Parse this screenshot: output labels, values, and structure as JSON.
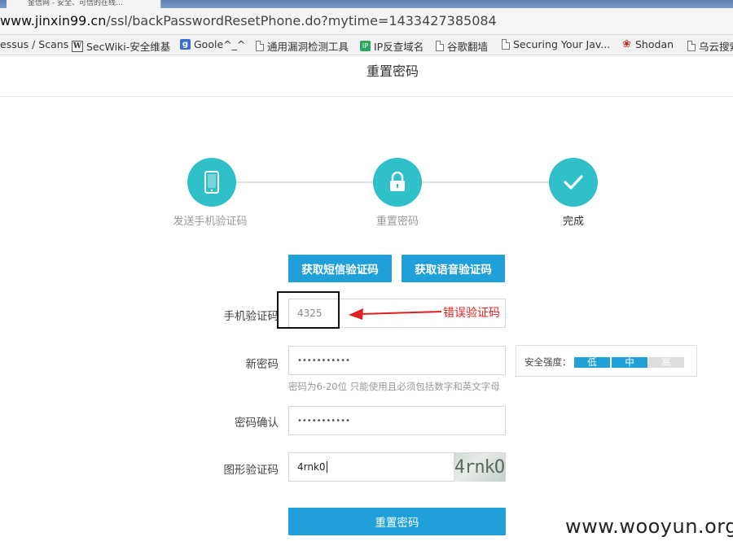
{
  "browser": {
    "tab_title": "金信网 - 安全、可信的在线…",
    "url_host": "www.jinxin99.cn",
    "url_path": "/ssl/backPasswordResetPhone.do?mytime=1433427385084",
    "bookmarks": [
      {
        "label": "essus / Scans",
        "icon": "none"
      },
      {
        "label": "SecWiki-安全维基",
        "icon": "w-icon"
      },
      {
        "label": "Goole^_^",
        "icon": "google-icon"
      },
      {
        "label": "通用漏洞检测工具",
        "icon": "page-icon"
      },
      {
        "label": "IP反查域名",
        "icon": "ip-icon"
      },
      {
        "label": "谷歌翻墙",
        "icon": "page-icon"
      },
      {
        "label": "Securing Your Jav...",
        "icon": "page-icon"
      },
      {
        "label": "Shodan",
        "icon": "shodan-icon"
      },
      {
        "label": "乌云搜索",
        "icon": "page-icon"
      }
    ]
  },
  "page": {
    "title": "重置密码",
    "steps": [
      {
        "label": "发送手机验证码",
        "icon": "phone-icon"
      },
      {
        "label": "重置密码",
        "icon": "lock-icon"
      },
      {
        "label": "完成",
        "icon": "check-icon"
      }
    ],
    "sms_button": "获取短信验证码",
    "voice_button": "获取语音验证码",
    "form": {
      "sms_code": {
        "label": "手机验证码",
        "value": "4325"
      },
      "new_password": {
        "label": "新密码",
        "value": "•••••••••••",
        "hint": "密码为6-20位 只能使用且必须包括数字和英文字母"
      },
      "confirm_password": {
        "label": "密码确认",
        "value": "•••••••••••"
      },
      "captcha": {
        "label": "图形验证码",
        "value": "4rnk0",
        "image_text": "4rnkO"
      }
    },
    "strength": {
      "label": "安全强度：",
      "levels": [
        "低",
        "中",
        "高"
      ],
      "level": 2
    },
    "submit_button": "重置密码",
    "annotation": "错误验证码",
    "watermark": "www.wooyun.org",
    "colors": {
      "accent": "#1fa0d8",
      "step": "#2fc0c9",
      "annotation": "#e02020"
    }
  }
}
